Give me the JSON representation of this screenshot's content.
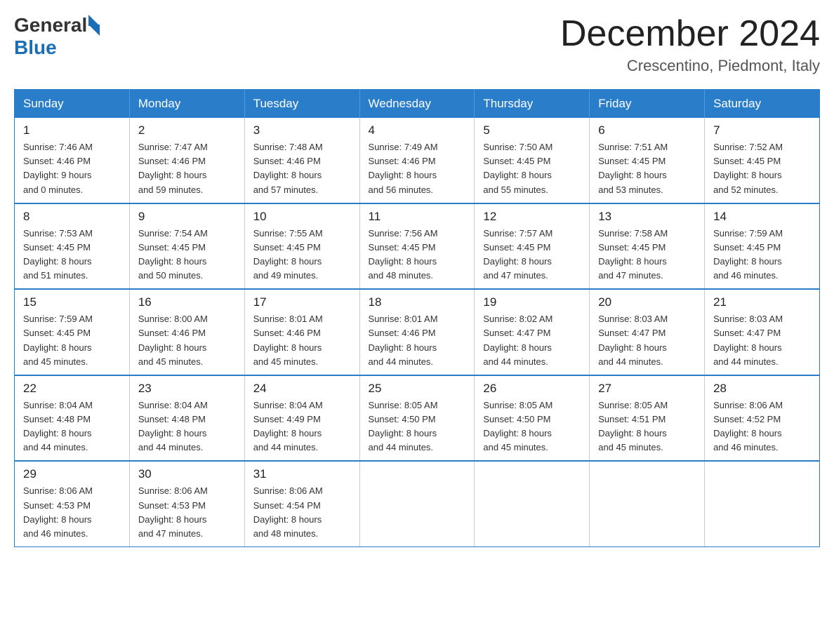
{
  "logo": {
    "general": "General",
    "blue": "Blue"
  },
  "title": "December 2024",
  "location": "Crescentino, Piedmont, Italy",
  "days_of_week": [
    "Sunday",
    "Monday",
    "Tuesday",
    "Wednesday",
    "Thursday",
    "Friday",
    "Saturday"
  ],
  "weeks": [
    [
      {
        "day": "1",
        "sunrise": "7:46 AM",
        "sunset": "4:46 PM",
        "daylight": "9 hours and 0 minutes."
      },
      {
        "day": "2",
        "sunrise": "7:47 AM",
        "sunset": "4:46 PM",
        "daylight": "8 hours and 59 minutes."
      },
      {
        "day": "3",
        "sunrise": "7:48 AM",
        "sunset": "4:46 PM",
        "daylight": "8 hours and 57 minutes."
      },
      {
        "day": "4",
        "sunrise": "7:49 AM",
        "sunset": "4:46 PM",
        "daylight": "8 hours and 56 minutes."
      },
      {
        "day": "5",
        "sunrise": "7:50 AM",
        "sunset": "4:45 PM",
        "daylight": "8 hours and 55 minutes."
      },
      {
        "day": "6",
        "sunrise": "7:51 AM",
        "sunset": "4:45 PM",
        "daylight": "8 hours and 53 minutes."
      },
      {
        "day": "7",
        "sunrise": "7:52 AM",
        "sunset": "4:45 PM",
        "daylight": "8 hours and 52 minutes."
      }
    ],
    [
      {
        "day": "8",
        "sunrise": "7:53 AM",
        "sunset": "4:45 PM",
        "daylight": "8 hours and 51 minutes."
      },
      {
        "day": "9",
        "sunrise": "7:54 AM",
        "sunset": "4:45 PM",
        "daylight": "8 hours and 50 minutes."
      },
      {
        "day": "10",
        "sunrise": "7:55 AM",
        "sunset": "4:45 PM",
        "daylight": "8 hours and 49 minutes."
      },
      {
        "day": "11",
        "sunrise": "7:56 AM",
        "sunset": "4:45 PM",
        "daylight": "8 hours and 48 minutes."
      },
      {
        "day": "12",
        "sunrise": "7:57 AM",
        "sunset": "4:45 PM",
        "daylight": "8 hours and 47 minutes."
      },
      {
        "day": "13",
        "sunrise": "7:58 AM",
        "sunset": "4:45 PM",
        "daylight": "8 hours and 47 minutes."
      },
      {
        "day": "14",
        "sunrise": "7:59 AM",
        "sunset": "4:45 PM",
        "daylight": "8 hours and 46 minutes."
      }
    ],
    [
      {
        "day": "15",
        "sunrise": "7:59 AM",
        "sunset": "4:45 PM",
        "daylight": "8 hours and 45 minutes."
      },
      {
        "day": "16",
        "sunrise": "8:00 AM",
        "sunset": "4:46 PM",
        "daylight": "8 hours and 45 minutes."
      },
      {
        "day": "17",
        "sunrise": "8:01 AM",
        "sunset": "4:46 PM",
        "daylight": "8 hours and 45 minutes."
      },
      {
        "day": "18",
        "sunrise": "8:01 AM",
        "sunset": "4:46 PM",
        "daylight": "8 hours and 44 minutes."
      },
      {
        "day": "19",
        "sunrise": "8:02 AM",
        "sunset": "4:47 PM",
        "daylight": "8 hours and 44 minutes."
      },
      {
        "day": "20",
        "sunrise": "8:03 AM",
        "sunset": "4:47 PM",
        "daylight": "8 hours and 44 minutes."
      },
      {
        "day": "21",
        "sunrise": "8:03 AM",
        "sunset": "4:47 PM",
        "daylight": "8 hours and 44 minutes."
      }
    ],
    [
      {
        "day": "22",
        "sunrise": "8:04 AM",
        "sunset": "4:48 PM",
        "daylight": "8 hours and 44 minutes."
      },
      {
        "day": "23",
        "sunrise": "8:04 AM",
        "sunset": "4:48 PM",
        "daylight": "8 hours and 44 minutes."
      },
      {
        "day": "24",
        "sunrise": "8:04 AM",
        "sunset": "4:49 PM",
        "daylight": "8 hours and 44 minutes."
      },
      {
        "day": "25",
        "sunrise": "8:05 AM",
        "sunset": "4:50 PM",
        "daylight": "8 hours and 44 minutes."
      },
      {
        "day": "26",
        "sunrise": "8:05 AM",
        "sunset": "4:50 PM",
        "daylight": "8 hours and 45 minutes."
      },
      {
        "day": "27",
        "sunrise": "8:05 AM",
        "sunset": "4:51 PM",
        "daylight": "8 hours and 45 minutes."
      },
      {
        "day": "28",
        "sunrise": "8:06 AM",
        "sunset": "4:52 PM",
        "daylight": "8 hours and 46 minutes."
      }
    ],
    [
      {
        "day": "29",
        "sunrise": "8:06 AM",
        "sunset": "4:53 PM",
        "daylight": "8 hours and 46 minutes."
      },
      {
        "day": "30",
        "sunrise": "8:06 AM",
        "sunset": "4:53 PM",
        "daylight": "8 hours and 47 minutes."
      },
      {
        "day": "31",
        "sunrise": "8:06 AM",
        "sunset": "4:54 PM",
        "daylight": "8 hours and 48 minutes."
      },
      null,
      null,
      null,
      null
    ]
  ],
  "labels": {
    "sunrise": "Sunrise:",
    "sunset": "Sunset:",
    "daylight": "Daylight:"
  }
}
